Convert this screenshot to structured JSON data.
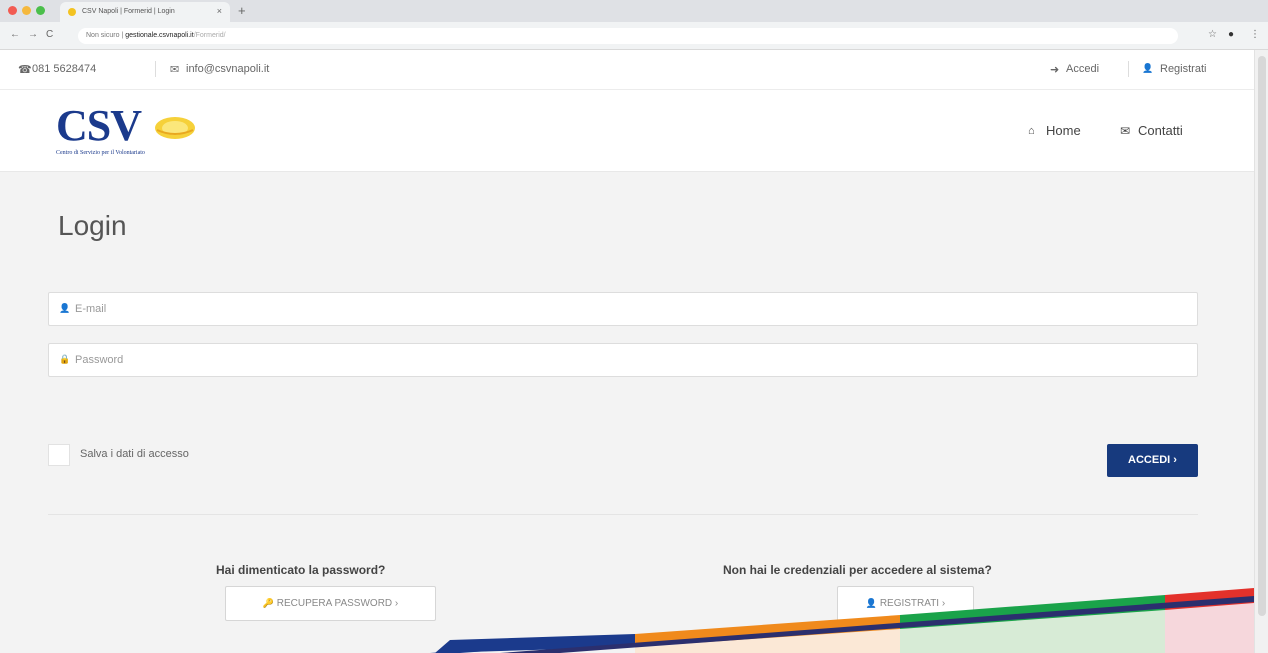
{
  "browser": {
    "tab_title": "CSV Napoli | Formerid | Login",
    "tab_close": "×",
    "new_tab": "+",
    "url_security": "Non sicuro",
    "url_domain": "gestionale.csvnapoli.it",
    "url_path": "/Formerid/",
    "nav_back": "←",
    "nav_forward": "→",
    "nav_reload": "C",
    "star": "☆",
    "menu": "⋮"
  },
  "topbar": {
    "phone_icon": "☎",
    "phone": "081 5628474",
    "email_icon": "✉",
    "email": "info@csvnapoli.it",
    "login_icon": "➜",
    "login": "Accedi",
    "register_icon": "👤",
    "register": "Registrati"
  },
  "header": {
    "logo_text": "CSV",
    "logo_sub": "Centro di Servizio per il Volontariato",
    "nav_home_icon": "⌂",
    "nav_home": "Home",
    "nav_contact_icon": "✉",
    "nav_contact": "Contatti"
  },
  "login": {
    "title": "Login",
    "email_placeholder": "E-mail",
    "password_placeholder": "Password",
    "user_icon": "👤",
    "lock_icon": "🔒",
    "remember_label": "Salva i dati di accesso",
    "submit_label": "ACCEDI ›"
  },
  "help": {
    "forgot_question": "Hai dimenticato la password?",
    "forgot_button": "RECUPERA PASSWORD ›",
    "key_icon": "🔑",
    "register_question": "Non hai le credenziali per accedere al sistema?",
    "register_button": "REGISTRATI ›",
    "register_icon": "👤"
  },
  "colors": {
    "brand_blue": "#173a7e",
    "stripe_orange": "#f08a1c",
    "stripe_green": "#1aa34a",
    "stripe_red": "#e3312b",
    "stripe_navy": "#1b3a8c"
  }
}
